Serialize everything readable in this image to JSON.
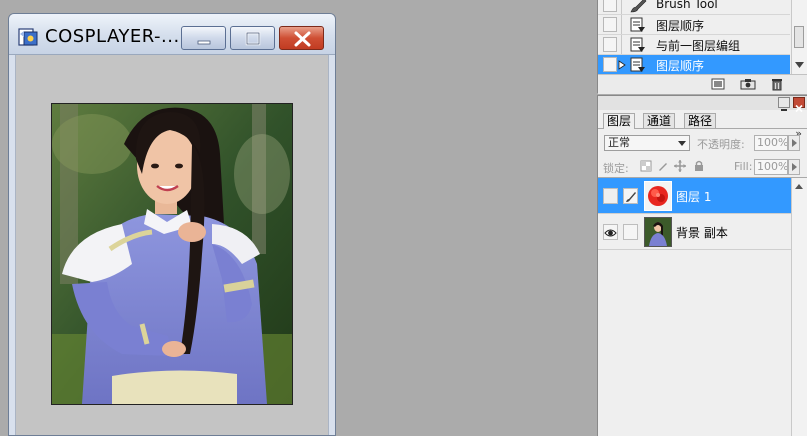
{
  "document_window": {
    "title": "COSPLAYER-...",
    "icons": {
      "app": "photoshop-document-icon",
      "minimize": "minimize-icon",
      "maximize": "maximize-icon",
      "close": "close-icon"
    },
    "colors": {
      "close_button": "#cf4f34",
      "titlebar": "#d4deec",
      "canvas_bg": "#c4c4c4"
    }
  },
  "history_panel": {
    "items": [
      {
        "label": "Brush Tool",
        "icon": "brush-icon",
        "selected": false,
        "current": false
      },
      {
        "label": "图层顺序",
        "icon": "history-state-icon",
        "selected": false,
        "current": false
      },
      {
        "label": "与前一图层编组",
        "icon": "history-state-icon",
        "selected": false,
        "current": false
      },
      {
        "label": "图层顺序",
        "icon": "history-state-icon",
        "selected": true,
        "current": true
      }
    ],
    "footer_icons": [
      "new-document-from-state-icon",
      "snapshot-camera-icon",
      "trash-icon"
    ]
  },
  "layers_panel": {
    "tabs": [
      {
        "label": "图层",
        "active": true
      },
      {
        "label": "通道",
        "active": false
      },
      {
        "label": "路径",
        "active": false
      }
    ],
    "blend_mode": "正常",
    "opacity_label": "不透明度:",
    "opacity_value": "100%",
    "lock_label": "锁定:",
    "fill_label": "Fill:",
    "fill_value": "100%",
    "layers": [
      {
        "name": "图层 1",
        "visible": false,
        "linked_icon": "brush-icon",
        "selected": true,
        "thumb": "red-rose-thumb"
      },
      {
        "name": "背景 副本",
        "visible": true,
        "linked_icon": "",
        "selected": false,
        "thumb": "photo-thumb"
      }
    ],
    "colors": {
      "selection": "#3399ff"
    }
  }
}
